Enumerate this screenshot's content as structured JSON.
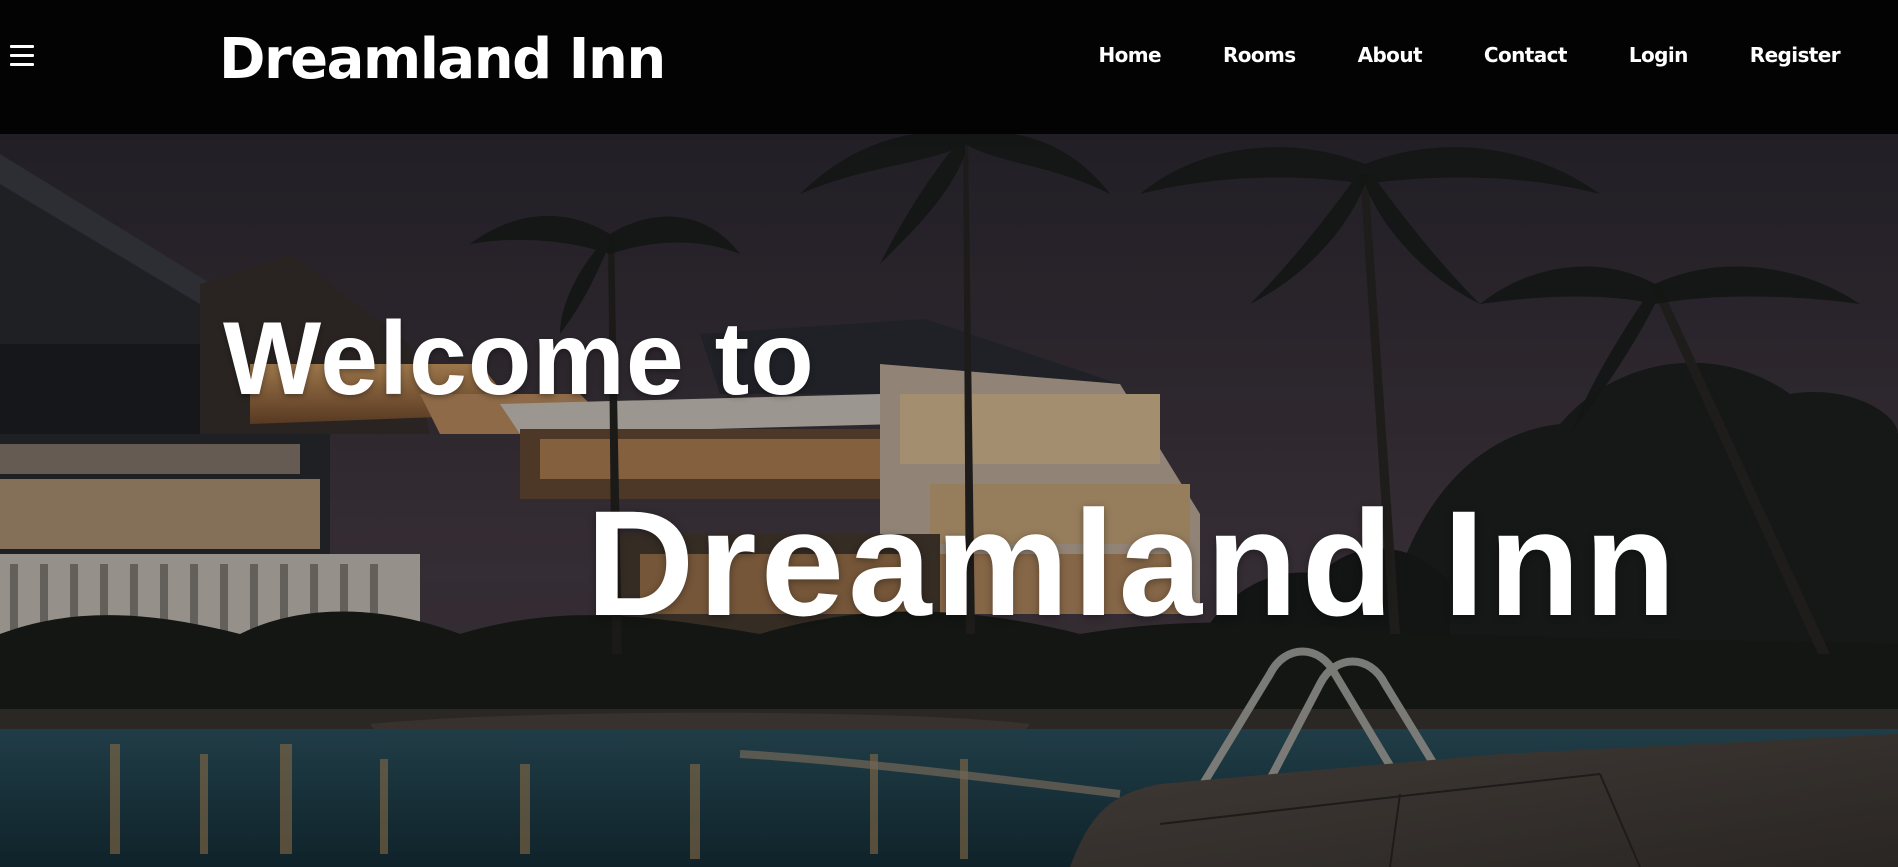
{
  "header": {
    "brand": "Dreamland Inn",
    "menu_icon": "hamburger-menu-icon",
    "nav": [
      {
        "label": "Home"
      },
      {
        "label": "Rooms"
      },
      {
        "label": "About"
      },
      {
        "label": "Contact"
      },
      {
        "label": "Login"
      },
      {
        "label": "Register"
      }
    ]
  },
  "hero": {
    "line1": "Welcome to",
    "line2": "Dreamland Inn",
    "image": "resort-at-night-with-pool-and-palm-trees"
  },
  "colors": {
    "header_bg": "#030303",
    "text": "#ffffff",
    "sky": "#3d3540",
    "pool": "#5fa2b4"
  }
}
